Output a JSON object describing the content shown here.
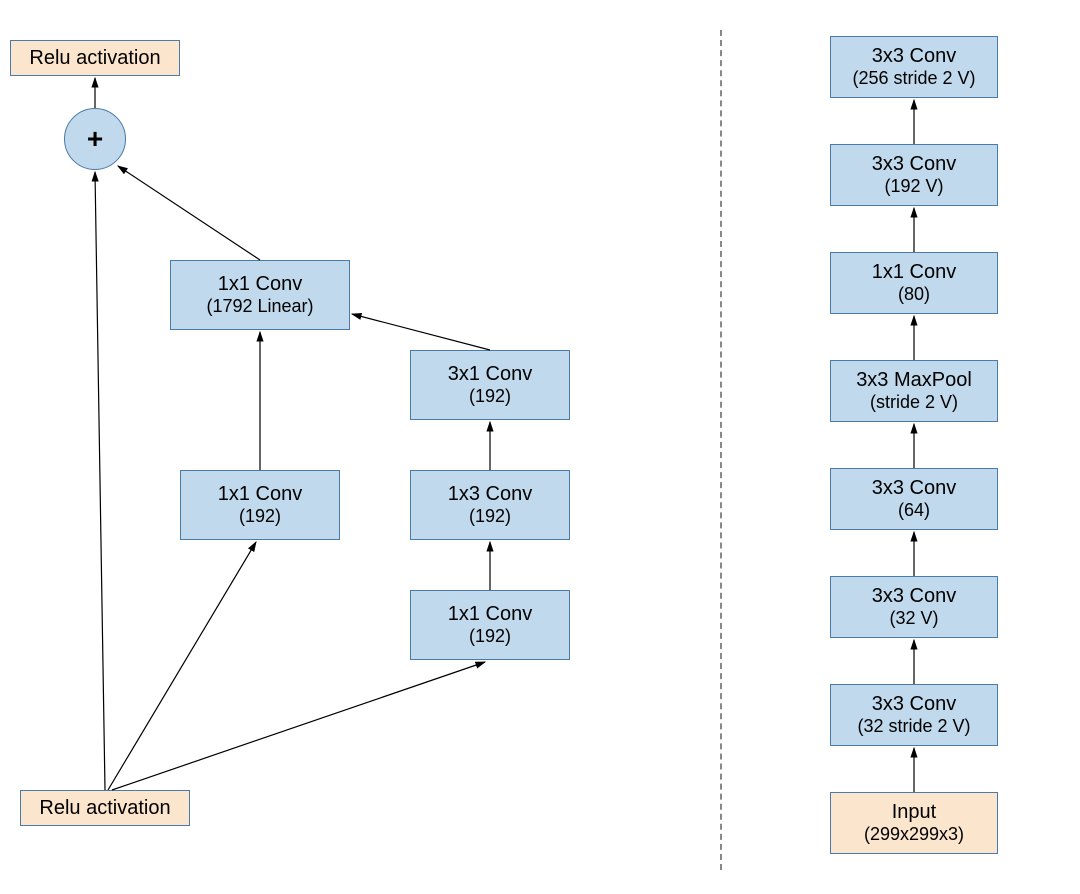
{
  "left": {
    "relu_top": "Relu activation",
    "relu_bottom": "Relu activation",
    "plus": "+",
    "conv_linear": {
      "l1": "1x1 Conv",
      "l2": "(1792 Linear)"
    },
    "b1": {
      "l1": "1x1 Conv",
      "l2": "(192)"
    },
    "b2a": {
      "l1": "1x1 Conv",
      "l2": "(192)"
    },
    "b2b": {
      "l1": "1x3 Conv",
      "l2": "(192)"
    },
    "b2c": {
      "l1": "3x1 Conv",
      "l2": "(192)"
    }
  },
  "right": {
    "input": {
      "l1": "Input",
      "l2": "(299x299x3)"
    },
    "s1": {
      "l1": "3x3 Conv",
      "l2": "(32 stride 2 V)"
    },
    "s2": {
      "l1": "3x3 Conv",
      "l2": "(32 V)"
    },
    "s3": {
      "l1": "3x3 Conv",
      "l2": "(64)"
    },
    "s4": {
      "l1": "3x3 MaxPool",
      "l2": "(stride 2 V)"
    },
    "s5": {
      "l1": "1x1 Conv",
      "l2": "(80)"
    },
    "s6": {
      "l1": "3x3 Conv",
      "l2": "(192 V)"
    },
    "s7": {
      "l1": "3x3 Conv",
      "l2": "(256 stride 2 V)"
    }
  }
}
